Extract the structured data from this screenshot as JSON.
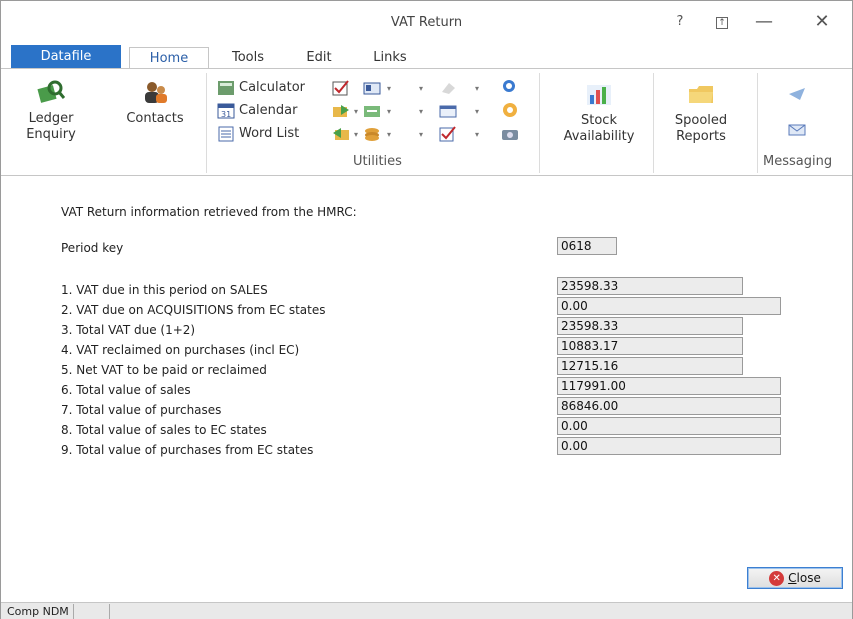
{
  "window": {
    "title": "VAT Return"
  },
  "titlebar": {
    "help": "?",
    "pin": "⊼",
    "minimize": "—",
    "close": "✕"
  },
  "tabs": {
    "datafile": "Datafile",
    "home": "Home",
    "tools": "Tools",
    "edit": "Edit",
    "links": "Links"
  },
  "ribbon": {
    "ledger_enquiry": [
      "Ledger",
      "Enquiry"
    ],
    "contacts": "Contacts",
    "calculator": "Calculator",
    "calendar": "Calendar",
    "word_list": "Word List",
    "utilities_group": "Utilities",
    "stock_availability": [
      "Stock",
      "Availability"
    ],
    "spooled_reports": [
      "Spooled",
      "Reports"
    ],
    "messaging_group": "Messaging",
    "calendar_badge": "31"
  },
  "form": {
    "intro": "VAT Return information retrieved from the HMRC:",
    "period_key_label": "Period key",
    "period_key": "0618",
    "rows": [
      {
        "label": "1. VAT due in this period on SALES",
        "value": "23598.33"
      },
      {
        "label": "2. VAT due on ACQUISITIONS from EC states",
        "value": "0.00"
      },
      {
        "label": "3. Total VAT due (1+2)",
        "value": "23598.33"
      },
      {
        "label": "4. VAT reclaimed on purchases (incl EC)",
        "value": "10883.17"
      },
      {
        "label": "5. Net VAT to be paid or reclaimed",
        "value": "12715.16"
      },
      {
        "label": "6. Total value of sales",
        "value": "117991.00"
      },
      {
        "label": "7. Total value of purchases",
        "value": "86846.00"
      },
      {
        "label": "8. Total value of sales to EC states",
        "value": "0.00"
      },
      {
        "label": "9. Total value of purchases from EC states",
        "value": "0.00"
      }
    ]
  },
  "buttons": {
    "close_prefix": "",
    "close_underlined": "C",
    "close_rest": "lose"
  },
  "status": {
    "company": "Comp NDM"
  },
  "colors": {
    "datafile_tab": "#2b73c8",
    "close_icon": "#d43b3b"
  }
}
